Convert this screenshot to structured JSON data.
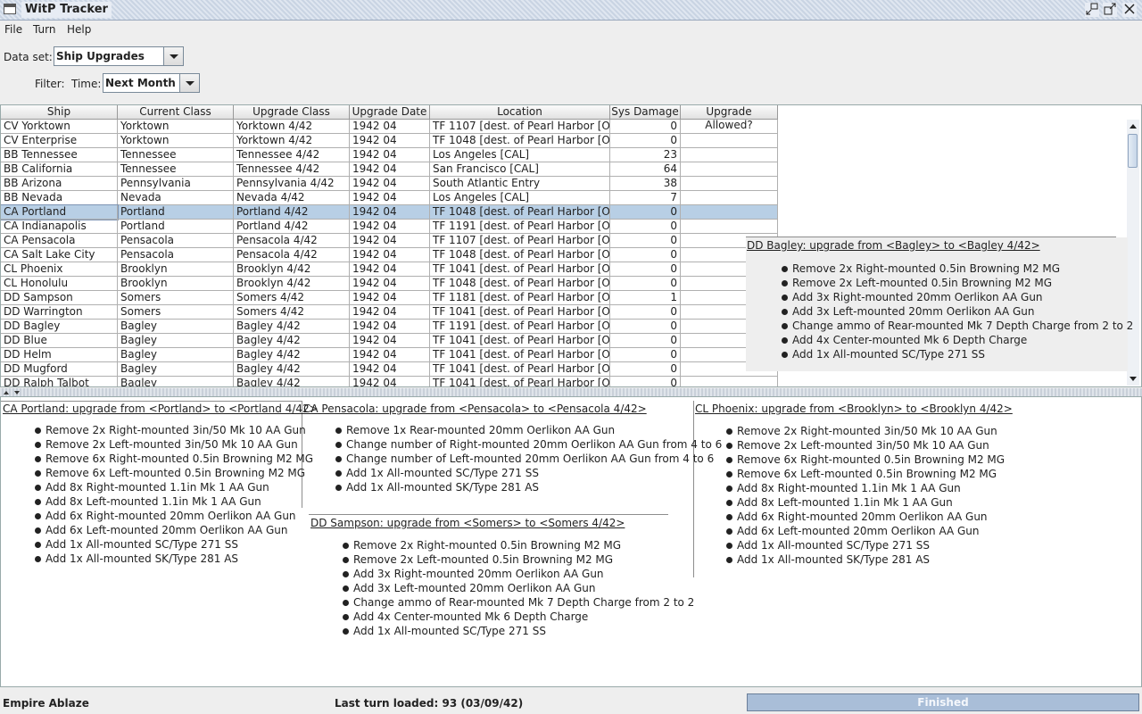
{
  "window": {
    "title": "WitP Tracker"
  },
  "menu": {
    "items": [
      "File",
      "Turn",
      "Help"
    ]
  },
  "dataset": {
    "label": "Data set:",
    "value": "Ship Upgrades"
  },
  "filter": {
    "label": "Filter:",
    "time_label": "Time:",
    "time_value": "Next Month"
  },
  "table": {
    "columns": [
      "Ship",
      "Current Class",
      "Upgrade Class",
      "Upgrade Date",
      "Location",
      "Sys Damage",
      "Upgrade Allowed?"
    ],
    "rows": [
      [
        "CV Yorktown",
        "Yorktown",
        "Yorktown 4/42",
        "1942 04",
        "TF 1107 [dest. of Pearl Harbor [Oa...",
        "0",
        ""
      ],
      [
        "CV Enterprise",
        "Yorktown",
        "Yorktown 4/42",
        "1942 04",
        "TF 1048 [dest. of Pearl Harbor [Oa...",
        "0",
        ""
      ],
      [
        "BB Tennessee",
        "Tennessee",
        "Tennessee 4/42",
        "1942 04",
        "Los Angeles [CAL]",
        "23",
        ""
      ],
      [
        "BB California",
        "Tennessee",
        "Tennessee 4/42",
        "1942 04",
        "San Francisco [CAL]",
        "64",
        ""
      ],
      [
        "BB Arizona",
        "Pennsylvania",
        "Pennsylvania 4/42",
        "1942 04",
        "South Atlantic Entry",
        "38",
        ""
      ],
      [
        "BB Nevada",
        "Nevada",
        "Nevada 4/42",
        "1942 04",
        "Los Angeles [CAL]",
        "7",
        ""
      ],
      [
        "CA Portland",
        "Portland",
        "Portland 4/42",
        "1942 04",
        "TF 1048 [dest. of Pearl Harbor [Oa...",
        "0",
        ""
      ],
      [
        "CA Indianapolis",
        "Portland",
        "Portland 4/42",
        "1942 04",
        "TF 1191 [dest. of Pearl Harbor [Oa...",
        "0",
        ""
      ],
      [
        "CA Pensacola",
        "Pensacola",
        "Pensacola 4/42",
        "1942 04",
        "TF 1107 [dest. of Pearl Harbor [Oa...",
        "0",
        ""
      ],
      [
        "CA Salt Lake City",
        "Pensacola",
        "Pensacola 4/42",
        "1942 04",
        "TF 1048 [dest. of Pearl Harbor [Oa...",
        "0",
        ""
      ],
      [
        "CL Phoenix",
        "Brooklyn",
        "Brooklyn 4/42",
        "1942 04",
        "TF 1041 [dest. of Pearl Harbor [Oa...",
        "0",
        ""
      ],
      [
        "CL Honolulu",
        "Brooklyn",
        "Brooklyn 4/42",
        "1942 04",
        "TF 1048 [dest. of Pearl Harbor [Oa...",
        "0",
        ""
      ],
      [
        "DD Sampson",
        "Somers",
        "Somers 4/42",
        "1942 04",
        "TF 1181 [dest. of Pearl Harbor [Oa...",
        "1",
        ""
      ],
      [
        "DD Warrington",
        "Somers",
        "Somers 4/42",
        "1942 04",
        "TF 1041 [dest. of Pearl Harbor [Oa...",
        "0",
        ""
      ],
      [
        "DD Bagley",
        "Bagley",
        "Bagley 4/42",
        "1942 04",
        "TF 1191 [dest. of Pearl Harbor [Oa...",
        "0",
        ""
      ],
      [
        "DD Blue",
        "Bagley",
        "Bagley 4/42",
        "1942 04",
        "TF 1041 [dest. of Pearl Harbor [Oa...",
        "0",
        ""
      ],
      [
        "DD Helm",
        "Bagley",
        "Bagley 4/42",
        "1942 04",
        "TF 1041 [dest. of Pearl Harbor [Oa...",
        "0",
        ""
      ],
      [
        "DD Mugford",
        "Bagley",
        "Bagley 4/42",
        "1942 04",
        "TF 1041 [dest. of Pearl Harbor [Oa...",
        "0",
        ""
      ],
      [
        "DD Ralph Talbot",
        "Bagley",
        "Bagley 4/42",
        "1942 04",
        "TF 1041 [dest. of Pearl Harbor [Oa...",
        "0",
        ""
      ]
    ],
    "selected_row": 6
  },
  "tooltip_panel": {
    "title": "DD Bagley: upgrade from <Bagley> to <Bagley 4/42>",
    "items": [
      "Remove 2x Right-mounted 0.5in Browning M2 MG",
      "Remove 2x Left-mounted 0.5in Browning M2 MG",
      "Add 3x Right-mounted 20mm Oerlikon AA Gun",
      "Add 3x Left-mounted 20mm Oerlikon AA Gun",
      "Change ammo of Rear-mounted Mk 7 Depth Charge from 2 to 2",
      "Add 4x Center-mounted Mk 6 Depth Charge",
      "Add 1x All-mounted SC/Type 271 SS"
    ]
  },
  "details": [
    {
      "title": "CA Portland: upgrade from <Portland> to <Portland 4/42>",
      "items": [
        "Remove 2x Right-mounted 3in/50 Mk 10 AA Gun",
        "Remove 2x Left-mounted 3in/50 Mk 10 AA Gun",
        "Remove 6x Right-mounted 0.5in Browning M2 MG",
        "Remove 6x Left-mounted 0.5in Browning M2 MG",
        "Add 8x Right-mounted 1.1in Mk 1 AA Gun",
        "Add 8x Left-mounted 1.1in Mk 1 AA Gun",
        "Add 6x Right-mounted 20mm Oerlikon AA Gun",
        "Add 6x Left-mounted 20mm Oerlikon AA Gun",
        "Add 1x All-mounted SC/Type 271 SS",
        "Add 1x All-mounted SK/Type 281 AS"
      ]
    },
    {
      "title": "CA Pensacola: upgrade from <Pensacola> to <Pensacola 4/42>",
      "items": [
        "Remove 1x Rear-mounted 20mm Oerlikon AA Gun",
        "Change number of Right-mounted 20mm Oerlikon AA Gun from 4 to 6",
        "Change number of Left-mounted 20mm Oerlikon AA Gun from 4 to 6",
        "Add 1x All-mounted SC/Type 271 SS",
        "Add 1x All-mounted SK/Type 281 AS"
      ]
    },
    {
      "title": "CL Phoenix: upgrade from <Brooklyn> to <Brooklyn 4/42>",
      "items": [
        "Remove 2x Right-mounted 3in/50 Mk 10 AA Gun",
        "Remove 2x Left-mounted 3in/50 Mk 10 AA Gun",
        "Remove 6x Right-mounted 0.5in Browning M2 MG",
        "Remove 6x Left-mounted 0.5in Browning M2 MG",
        "Add 8x Right-mounted 1.1in Mk 1 AA Gun",
        "Add 8x Left-mounted 1.1in Mk 1 AA Gun",
        "Add 6x Right-mounted 20mm Oerlikon AA Gun",
        "Add 6x Left-mounted 20mm Oerlikon AA Gun",
        "Add 1x All-mounted SC/Type 271 SS",
        "Add 1x All-mounted SK/Type 281 AS"
      ]
    },
    {
      "title": "DD Sampson: upgrade from <Somers> to <Somers 4/42>",
      "items": [
        "Remove 2x Right-mounted 0.5in Browning M2 MG",
        "Remove 2x Left-mounted 0.5in Browning M2 MG",
        "Add 3x Right-mounted 20mm Oerlikon AA Gun",
        "Add 3x Left-mounted 20mm Oerlikon AA Gun",
        "Change ammo of Rear-mounted Mk 7 Depth Charge from 2 to 2",
        "Add 4x Center-mounted Mk 6 Depth Charge",
        "Add 1x All-mounted SC/Type 271 SS"
      ]
    }
  ],
  "status": {
    "left": "Empire Ablaze",
    "middle": "Last turn loaded: 93 (03/09/42)",
    "progress_label": "Finished",
    "progress": 1.0
  },
  "icons": {
    "window_icon": "app-window-icon",
    "restore": "restore-icon",
    "maximize": "maximize-icon",
    "close": "close-icon"
  }
}
